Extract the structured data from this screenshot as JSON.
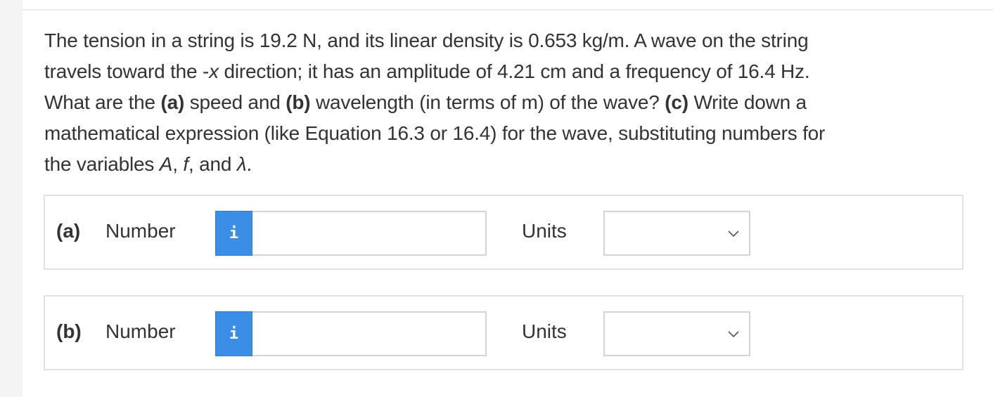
{
  "question": {
    "line1": "The tension in a string is 19.2 N, and its linear density is 0.653 kg/m. A wave on the string",
    "line2_prefix": "travels toward the -",
    "line2_var": "x",
    "line2_suffix": " direction; it has an amplitude of 4.21 cm and a frequency of 16.4 Hz.",
    "line3_prefix": "What are the ",
    "part_a": "(a)",
    "speed_text": " speed and ",
    "part_b": "(b)",
    "wavelength_text": " wavelength (in terms of m) of the wave? ",
    "part_c": "(c)",
    "line3_suffix": " Write down a",
    "line4": "mathematical expression (like Equation 16.3 or 16.4) for the wave, substituting numbers for",
    "line5_prefix": "the variables ",
    "var_A": "A",
    "sep1": ", ",
    "var_f": "f",
    "sep2": ", and ",
    "var_lambda": "λ",
    "line5_suffix": "."
  },
  "answers": [
    {
      "part": "(a)",
      "number_label": "Number",
      "info_icon": "i",
      "number_value": "",
      "units_label": "Units",
      "units_value": ""
    },
    {
      "part": "(b)",
      "number_label": "Number",
      "info_icon": "i",
      "number_value": "",
      "units_label": "Units",
      "units_value": ""
    }
  ],
  "colors": {
    "info_button": "#3a8ee6",
    "text": "#333333",
    "border": "#e2e2e2"
  },
  "icons": {
    "info": "info-icon",
    "dropdown": "chevron-down-icon"
  }
}
